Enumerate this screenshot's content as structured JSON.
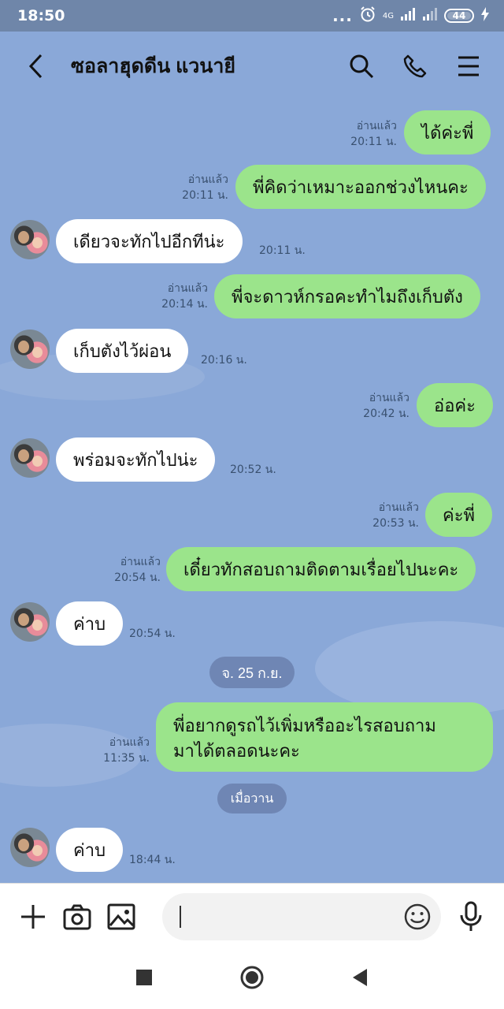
{
  "status_bar": {
    "time": "18:50",
    "dots": "...",
    "network": "4G",
    "battery": "44"
  },
  "header": {
    "title": "ซอลาฮุดดีน แวนายี"
  },
  "messages": [
    {
      "dir": "out",
      "text": "ได้ค่ะพี่",
      "read": "อ่านแล้ว",
      "time": "20:11 น."
    },
    {
      "dir": "out",
      "text": "พี่คิดว่าเหมาะออกช่วงไหนคะ",
      "read": "อ่านแล้ว",
      "time": "20:11 น."
    },
    {
      "dir": "in",
      "text": "เดียวจะทักไปอีกทีน่ะ",
      "time": "20:11 น."
    },
    {
      "dir": "out",
      "text": "พี่จะดาวห์กรอคะทำไมถึงเก็บตัง",
      "read": "อ่านแล้ว",
      "time": "20:14 น."
    },
    {
      "dir": "in",
      "text": "เก็บตังไว้ผ่อน",
      "time": "20:16 น."
    },
    {
      "dir": "out",
      "text": "อ่อค่ะ",
      "read": "อ่านแล้ว",
      "time": "20:42 น."
    },
    {
      "dir": "in",
      "text": "พร่อมจะทักไปน่ะ",
      "time": "20:52 น."
    },
    {
      "dir": "out",
      "text": "ค่ะพี่",
      "read": "อ่านแล้ว",
      "time": "20:53 น."
    },
    {
      "dir": "out",
      "text": "เดี๋ยวทักสอบถามติดตามเรื่อยไปนะคะ",
      "read": "อ่านแล้ว",
      "time": "20:54 น."
    },
    {
      "dir": "in",
      "text": "ค่าบ",
      "time": "20:54 น."
    },
    {
      "dir": "out",
      "line1": "พี่อยากดูรถไว้เพิ่มหรืออะไรสอบถาม",
      "line2": "มาได้ตลอดนะคะ",
      "read": "อ่านแล้ว",
      "time": "11:35 น."
    },
    {
      "dir": "in",
      "text": "ค่าบ",
      "time": "18:44 น."
    }
  ],
  "date_chips": {
    "sep1": "จ. 25 ก.ย.",
    "sep2": "เมื่อวาน"
  },
  "icons": {
    "back": "chevron-left-icon",
    "search": "search-icon",
    "call": "phone-icon",
    "menu": "menu-icon",
    "add": "plus-icon",
    "camera": "camera-icon",
    "image": "image-icon",
    "emoji": "emoji-icon",
    "mic": "microphone-icon"
  },
  "colors": {
    "background": "#8aa8d8",
    "outgoing_bubble": "#9be48b",
    "incoming_bubble": "#ffffff",
    "date_chip": "#6f86b4"
  }
}
